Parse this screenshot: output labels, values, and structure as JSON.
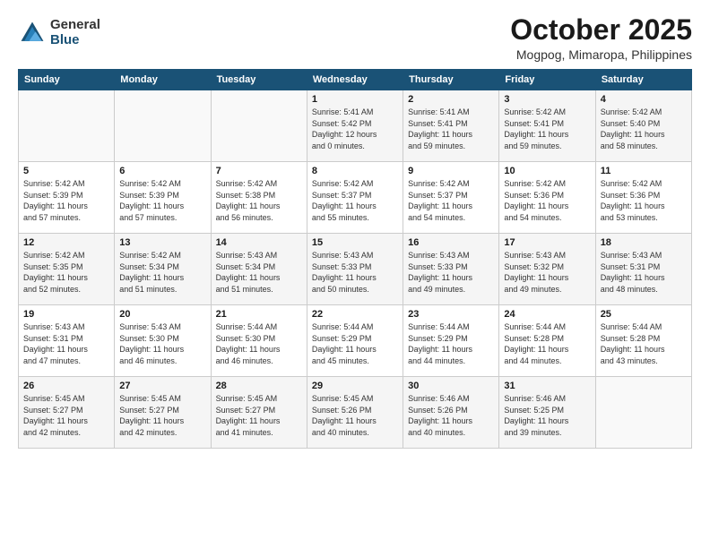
{
  "logo": {
    "general": "General",
    "blue": "Blue"
  },
  "title": "October 2025",
  "location": "Mogpog, Mimaropa, Philippines",
  "headers": [
    "Sunday",
    "Monday",
    "Tuesday",
    "Wednesday",
    "Thursday",
    "Friday",
    "Saturday"
  ],
  "rows": [
    {
      "cells": [
        {
          "day": "",
          "info": ""
        },
        {
          "day": "",
          "info": ""
        },
        {
          "day": "",
          "info": ""
        },
        {
          "day": "1",
          "info": "Sunrise: 5:41 AM\nSunset: 5:42 PM\nDaylight: 12 hours\nand 0 minutes."
        },
        {
          "day": "2",
          "info": "Sunrise: 5:41 AM\nSunset: 5:41 PM\nDaylight: 11 hours\nand 59 minutes."
        },
        {
          "day": "3",
          "info": "Sunrise: 5:42 AM\nSunset: 5:41 PM\nDaylight: 11 hours\nand 59 minutes."
        },
        {
          "day": "4",
          "info": "Sunrise: 5:42 AM\nSunset: 5:40 PM\nDaylight: 11 hours\nand 58 minutes."
        }
      ]
    },
    {
      "cells": [
        {
          "day": "5",
          "info": "Sunrise: 5:42 AM\nSunset: 5:39 PM\nDaylight: 11 hours\nand 57 minutes."
        },
        {
          "day": "6",
          "info": "Sunrise: 5:42 AM\nSunset: 5:39 PM\nDaylight: 11 hours\nand 57 minutes."
        },
        {
          "day": "7",
          "info": "Sunrise: 5:42 AM\nSunset: 5:38 PM\nDaylight: 11 hours\nand 56 minutes."
        },
        {
          "day": "8",
          "info": "Sunrise: 5:42 AM\nSunset: 5:37 PM\nDaylight: 11 hours\nand 55 minutes."
        },
        {
          "day": "9",
          "info": "Sunrise: 5:42 AM\nSunset: 5:37 PM\nDaylight: 11 hours\nand 54 minutes."
        },
        {
          "day": "10",
          "info": "Sunrise: 5:42 AM\nSunset: 5:36 PM\nDaylight: 11 hours\nand 54 minutes."
        },
        {
          "day": "11",
          "info": "Sunrise: 5:42 AM\nSunset: 5:36 PM\nDaylight: 11 hours\nand 53 minutes."
        }
      ]
    },
    {
      "cells": [
        {
          "day": "12",
          "info": "Sunrise: 5:42 AM\nSunset: 5:35 PM\nDaylight: 11 hours\nand 52 minutes."
        },
        {
          "day": "13",
          "info": "Sunrise: 5:42 AM\nSunset: 5:34 PM\nDaylight: 11 hours\nand 51 minutes."
        },
        {
          "day": "14",
          "info": "Sunrise: 5:43 AM\nSunset: 5:34 PM\nDaylight: 11 hours\nand 51 minutes."
        },
        {
          "day": "15",
          "info": "Sunrise: 5:43 AM\nSunset: 5:33 PM\nDaylight: 11 hours\nand 50 minutes."
        },
        {
          "day": "16",
          "info": "Sunrise: 5:43 AM\nSunset: 5:33 PM\nDaylight: 11 hours\nand 49 minutes."
        },
        {
          "day": "17",
          "info": "Sunrise: 5:43 AM\nSunset: 5:32 PM\nDaylight: 11 hours\nand 49 minutes."
        },
        {
          "day": "18",
          "info": "Sunrise: 5:43 AM\nSunset: 5:31 PM\nDaylight: 11 hours\nand 48 minutes."
        }
      ]
    },
    {
      "cells": [
        {
          "day": "19",
          "info": "Sunrise: 5:43 AM\nSunset: 5:31 PM\nDaylight: 11 hours\nand 47 minutes."
        },
        {
          "day": "20",
          "info": "Sunrise: 5:43 AM\nSunset: 5:30 PM\nDaylight: 11 hours\nand 46 minutes."
        },
        {
          "day": "21",
          "info": "Sunrise: 5:44 AM\nSunset: 5:30 PM\nDaylight: 11 hours\nand 46 minutes."
        },
        {
          "day": "22",
          "info": "Sunrise: 5:44 AM\nSunset: 5:29 PM\nDaylight: 11 hours\nand 45 minutes."
        },
        {
          "day": "23",
          "info": "Sunrise: 5:44 AM\nSunset: 5:29 PM\nDaylight: 11 hours\nand 44 minutes."
        },
        {
          "day": "24",
          "info": "Sunrise: 5:44 AM\nSunset: 5:28 PM\nDaylight: 11 hours\nand 44 minutes."
        },
        {
          "day": "25",
          "info": "Sunrise: 5:44 AM\nSunset: 5:28 PM\nDaylight: 11 hours\nand 43 minutes."
        }
      ]
    },
    {
      "cells": [
        {
          "day": "26",
          "info": "Sunrise: 5:45 AM\nSunset: 5:27 PM\nDaylight: 11 hours\nand 42 minutes."
        },
        {
          "day": "27",
          "info": "Sunrise: 5:45 AM\nSunset: 5:27 PM\nDaylight: 11 hours\nand 42 minutes."
        },
        {
          "day": "28",
          "info": "Sunrise: 5:45 AM\nSunset: 5:27 PM\nDaylight: 11 hours\nand 41 minutes."
        },
        {
          "day": "29",
          "info": "Sunrise: 5:45 AM\nSunset: 5:26 PM\nDaylight: 11 hours\nand 40 minutes."
        },
        {
          "day": "30",
          "info": "Sunrise: 5:46 AM\nSunset: 5:26 PM\nDaylight: 11 hours\nand 40 minutes."
        },
        {
          "day": "31",
          "info": "Sunrise: 5:46 AM\nSunset: 5:25 PM\nDaylight: 11 hours\nand 39 minutes."
        },
        {
          "day": "",
          "info": ""
        }
      ]
    }
  ]
}
